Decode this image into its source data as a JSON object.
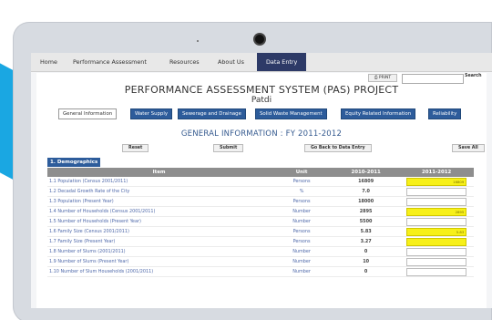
{
  "nav": {
    "items": [
      {
        "label": "Home"
      },
      {
        "label": "Performance Assessment"
      },
      {
        "label": "Resources"
      },
      {
        "label": "About Us"
      },
      {
        "label": "Data Entry"
      }
    ]
  },
  "toolbar": {
    "print_label": "PRINT",
    "search_label": "Search",
    "search_value": ""
  },
  "header": {
    "title": "PERFORMANCE ASSESSMENT SYSTEM (PAS) PROJECT",
    "subtitle": "Patdi"
  },
  "tabs": [
    {
      "label": "General Information"
    },
    {
      "label": "Water Supply"
    },
    {
      "label": "Sewerage and Drainage"
    },
    {
      "label": "Solid Waste Management"
    },
    {
      "label": "Equity Related Information"
    },
    {
      "label": "Reliability"
    }
  ],
  "section": {
    "title": "GENERAL INFORMATION : FY 2011-2012"
  },
  "actions": {
    "reset": "Reset",
    "submit": "Submit",
    "back": "Go Back to Data Entry",
    "save_all": "Save All"
  },
  "demographics": {
    "heading": "1. Demographics",
    "columns": {
      "item": "Item",
      "unit": "Unit",
      "y2010": "2010-2011",
      "y2011": "2011-2012"
    },
    "rows": [
      {
        "item": "1.1 Population (Census 2001/2011)",
        "unit": "Persons",
        "v2010": "16809",
        "v2011": "16809",
        "highlight": true
      },
      {
        "item": "1.2 Decadal Growth Rate of the City",
        "unit": "%",
        "v2010": "7.0",
        "v2011": "",
        "highlight": false
      },
      {
        "item": "1.3 Population (Present Year)",
        "unit": "Persons",
        "v2010": "18000",
        "v2011": "",
        "highlight": false
      },
      {
        "item": "1.4 Number of Households (Census 2001/2011)",
        "unit": "Number",
        "v2010": "2895",
        "v2011": "2895",
        "highlight": true
      },
      {
        "item": "1.5 Number of Households (Present Year)",
        "unit": "Number",
        "v2010": "5500",
        "v2011": "",
        "highlight": false
      },
      {
        "item": "1.6 Family Size (Census 2001/2011)",
        "unit": "Persons",
        "v2010": "5.83",
        "v2011": "5.83",
        "highlight": true
      },
      {
        "item": "1.7 Family Size (Present Year)",
        "unit": "Persons",
        "v2010": "3.27",
        "v2011": "",
        "highlight": true
      },
      {
        "item": "1.8 Number of Slums (2001/2011)",
        "unit": "Number",
        "v2010": "0",
        "v2011": "",
        "highlight": false
      },
      {
        "item": "1.9 Number of Slums (Present Year)",
        "unit": "Number",
        "v2010": "10",
        "v2011": "",
        "highlight": false
      },
      {
        "item": "1.10 Number of Slum Households (2001/2011)",
        "unit": "Number",
        "v2010": "0",
        "v2011": "",
        "highlight": false
      }
    ]
  },
  "colors": {
    "accent": "#2d5c9b",
    "nav_active": "#2d3a67",
    "highlight_input": "#f7f019",
    "side_shape": "#1aa7e2"
  }
}
